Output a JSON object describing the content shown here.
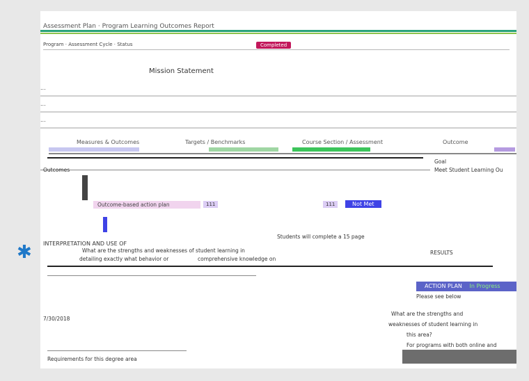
{
  "header": {
    "title": "Assessment Plan · Program Learning Outcomes Report",
    "completed_badge": "Completed"
  },
  "sub_row": "Program · Assessment Cycle · Status",
  "mission": {
    "title": "Mission Statement",
    "lines": [
      "...",
      "...",
      "..."
    ]
  },
  "table": {
    "headers": [
      "Measures & Outcomes",
      "Targets / Benchmarks",
      "Course Section / Assessment",
      "Outcome"
    ],
    "header_colors": [
      "#c7c7f0",
      "#9fd6a3",
      "#3cc45a",
      "#b59be0"
    ],
    "rows": {
      "goal_label": "Goal",
      "outcomes_label": "Outcomes",
      "meet_label": "Meet Student Learning Ou",
      "outcome_action_plan": "Outcome-based action plan",
      "num_a": "111",
      "num_b": "111",
      "not_met": "Not Met",
      "students_text": "Students will complete a 15 page",
      "interpretation": "INTERPRETATION AND USE OF",
      "interp_q1": "What are the strengths and weaknesses of student learning in",
      "interp_q2": "detailing exactly what behavior or",
      "interp_q3": "comprehensive knowledge on",
      "results_label": "RESULTS",
      "action_plan": "ACTION PLAN",
      "in_progress": "In Progress",
      "please_see": "Please see below",
      "date": "7/30/2018",
      "strengths_q": "What are the strengths and",
      "weaknesses_q": "weaknesses of student learning in",
      "this_area": "this area?",
      "online_q": "For programs with both online and",
      "footer_text": "Requirements for this degree area"
    }
  },
  "colors": {
    "accent_green": "#2aa37a",
    "badge_pink": "#c2185b",
    "not_met_blue": "#3f43e6",
    "action_plan_bg": "#5b63c8",
    "star_blue": "#1f78c8"
  },
  "icons": {
    "star": "asterisk-icon"
  }
}
